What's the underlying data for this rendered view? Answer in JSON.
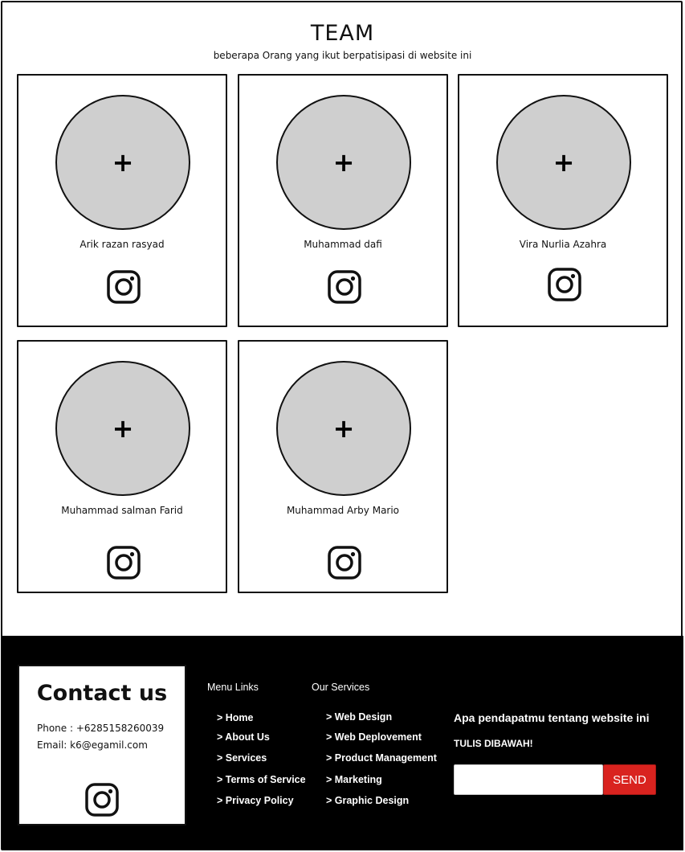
{
  "team": {
    "title": "TEAM",
    "subtitle": "beberapa Orang yang ikut berpatisipasi di website ini",
    "members": [
      {
        "name": "Arik razan rasyad",
        "social_icon": "instagram-icon"
      },
      {
        "name": "Muhammad dafi",
        "social_icon": "instagram-icon"
      },
      {
        "name": "Vira Nurlia Azahra",
        "social_icon": "instagram-icon"
      },
      {
        "name": "Muhammad salman Farid",
        "social_icon": "instagram-icon"
      },
      {
        "name": "Muhammad Arby Mario",
        "social_icon": "instagram-icon"
      }
    ],
    "avatar_placeholder": "+"
  },
  "footer": {
    "contact": {
      "title": "Contact us",
      "phone": "Phone : +6285158260039",
      "email": "Email: k6@egamil.com",
      "social_icon": "instagram-icon"
    },
    "menu_links": {
      "heading": "Menu Links",
      "items": [
        "> Home",
        "> About Us",
        "> Services",
        "> Terms of Service",
        "> Privacy Policy"
      ]
    },
    "services": {
      "heading": "Our Services",
      "items": [
        "> Web Design",
        "> Web Deplovement",
        "> Product Management",
        "> Marketing",
        "> Graphic Design"
      ]
    },
    "feedback": {
      "question": "Apa pendapatmu tentang website ini",
      "instruction": "TULIS DIBAWAH!",
      "input_value": "",
      "send_label": "SEND"
    }
  },
  "colors": {
    "avatar_fill": "#cfcfcf",
    "footer_bg": "#000000",
    "send_button": "#d9231f"
  }
}
